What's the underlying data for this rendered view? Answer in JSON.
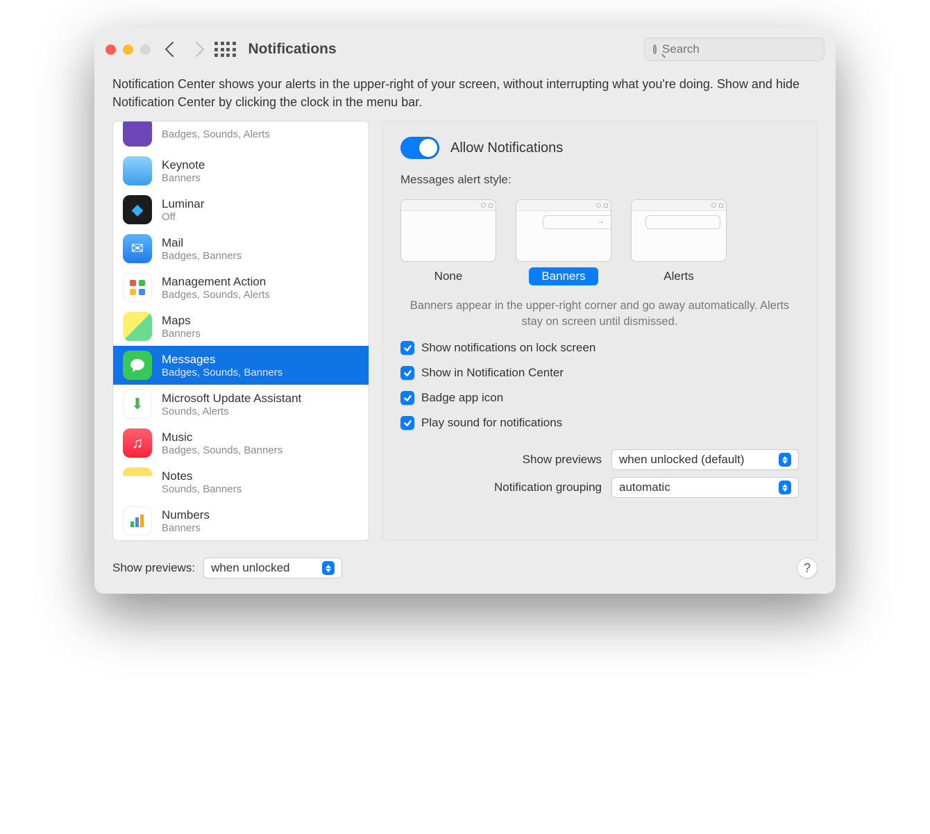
{
  "window": {
    "title": "Notifications"
  },
  "search": {
    "placeholder": "Search"
  },
  "intro": "Notification Center shows your alerts in the upper-right of your screen, without interrupting what you're doing. Show and hide Notification Center by clicking the clock in the menu bar.",
  "apps": [
    {
      "name": "",
      "sub": "Badges, Sounds, Alerts",
      "icon_bg": "#6e45b8",
      "glyph": "",
      "selected": false
    },
    {
      "name": "Keynote",
      "sub": "Banners",
      "icon_bg": "#ffffff",
      "glyph": "",
      "selected": false
    },
    {
      "name": "Luminar",
      "sub": "Off",
      "icon_bg": "#1c1c1c",
      "glyph": "◆",
      "selected": false
    },
    {
      "name": "Mail",
      "sub": "Badges, Banners",
      "icon_bg": "#ffffff",
      "glyph": "✉",
      "selected": false
    },
    {
      "name": "Management Action",
      "sub": "Badges, Sounds, Alerts",
      "icon_bg": "#ffffff",
      "glyph": "✧",
      "selected": false
    },
    {
      "name": "Maps",
      "sub": "Banners",
      "icon_bg": "#ffffff",
      "glyph": "",
      "selected": false
    },
    {
      "name": "Messages",
      "sub": "Badges, Sounds, Banners",
      "icon_bg": "#39c759",
      "glyph": "💬",
      "selected": true
    },
    {
      "name": "Microsoft Update Assistant",
      "sub": "Sounds, Alerts",
      "icon_bg": "#ffffff",
      "glyph": "⬇",
      "selected": false
    },
    {
      "name": "Music",
      "sub": "Badges, Sounds, Banners",
      "icon_bg": "#fc3150",
      "glyph": "♫",
      "selected": false
    },
    {
      "name": "Notes",
      "sub": "Sounds, Banners",
      "icon_bg": "#fff0a0",
      "glyph": "",
      "selected": false
    },
    {
      "name": "Numbers",
      "sub": "Banners",
      "icon_bg": "#ffffff",
      "glyph": "",
      "selected": false
    }
  ],
  "detail": {
    "allow_label": "Allow Notifications",
    "allow_on": true,
    "style_label": "Messages alert style:",
    "styles": [
      {
        "name": "None",
        "selected": false
      },
      {
        "name": "Banners",
        "selected": true
      },
      {
        "name": "Alerts",
        "selected": false
      }
    ],
    "style_help": "Banners appear in the upper-right corner and go away automatically. Alerts stay on screen until dismissed.",
    "checks": [
      {
        "label": "Show notifications on lock screen",
        "checked": true
      },
      {
        "label": "Show in Notification Center",
        "checked": true
      },
      {
        "label": "Badge app icon",
        "checked": true
      },
      {
        "label": "Play sound for notifications",
        "checked": true
      }
    ],
    "selects": [
      {
        "label": "Show previews",
        "value": "when unlocked (default)"
      },
      {
        "label": "Notification grouping",
        "value": "automatic"
      }
    ]
  },
  "footer": {
    "previews_label": "Show previews:",
    "previews_value": "when unlocked"
  }
}
